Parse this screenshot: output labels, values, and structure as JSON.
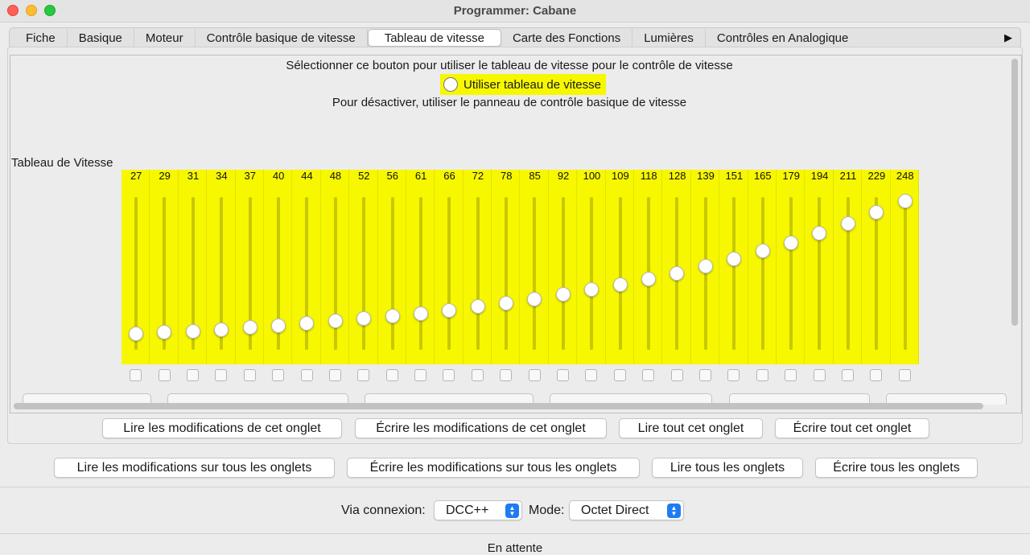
{
  "window": {
    "title": "Programmer: Cabane"
  },
  "tabs": [
    {
      "label": "Fiche"
    },
    {
      "label": "Basique"
    },
    {
      "label": "Moteur"
    },
    {
      "label": "Contrôle basique de vitesse"
    },
    {
      "label": "Tableau de vitesse",
      "selected": true
    },
    {
      "label": "Carte des Fonctions"
    },
    {
      "label": "Lumières"
    },
    {
      "label": "Contrôles en Analogique"
    }
  ],
  "tab_more_icon": "triangle-right-icon",
  "speed_table": {
    "intro": "Sélectionner ce bouton pour utiliser le tableau de vitesse pour le contrôle de vitesse",
    "radio_label": "Utiliser tableau de vitesse",
    "radio_selected": false,
    "disable_hint": "Pour désactiver, utiliser le panneau de contrôle basique de vitesse",
    "section_label": "Tableau de Vitesse",
    "highlight_color": "#f7f700",
    "max_value": 255,
    "values": [
      27,
      29,
      31,
      34,
      37,
      40,
      44,
      48,
      52,
      56,
      61,
      66,
      72,
      78,
      85,
      92,
      100,
      109,
      118,
      128,
      139,
      151,
      165,
      179,
      194,
      211,
      229,
      248
    ]
  },
  "tab_buttons": {
    "read_changes": "Lire les modifications de cet onglet",
    "write_changes": "Écrire les modifications de cet onglet",
    "read_all": "Lire tout cet onglet",
    "write_all": "Écrire tout cet onglet"
  },
  "global_buttons": {
    "read_changes": "Lire les modifications sur tous les onglets",
    "write_changes": "Écrire les modifications sur tous les onglets",
    "read_all": "Lire tous les onglets",
    "write_all": "Écrire tous les onglets"
  },
  "connection": {
    "via_label": "Via connexion:",
    "via_value": "DCC++",
    "mode_label": "Mode:",
    "mode_value": "Octet Direct"
  },
  "status": "En attente",
  "accent_color": "#1f7bf2"
}
